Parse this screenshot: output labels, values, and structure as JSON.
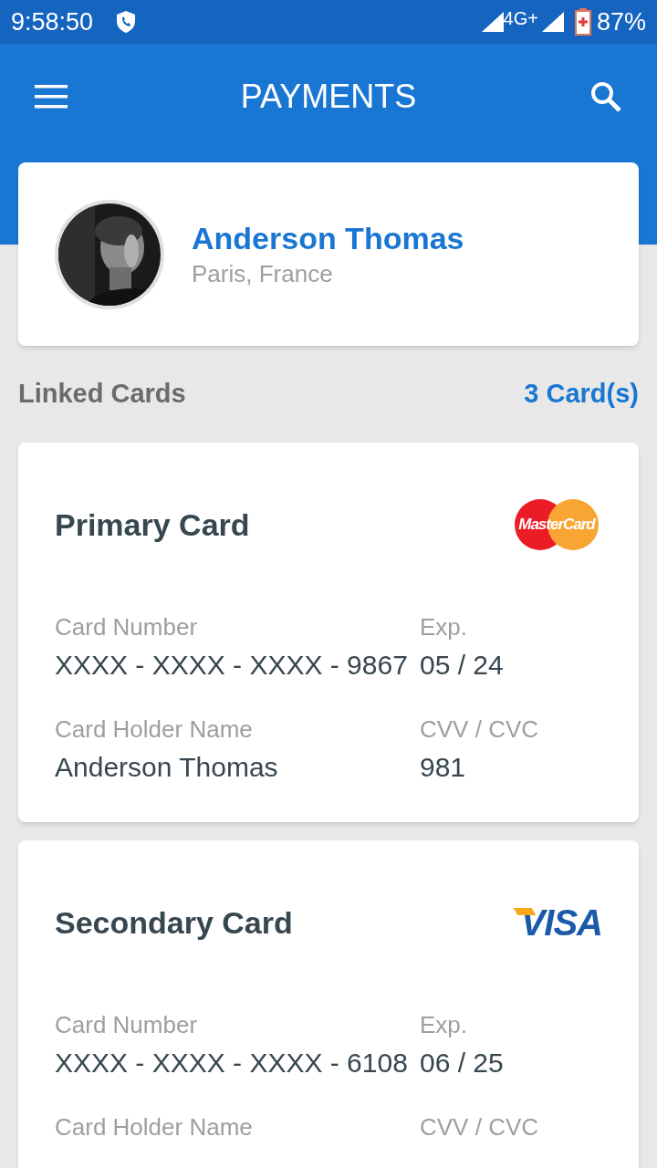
{
  "status_bar": {
    "time": "9:58:50",
    "network": "4G+",
    "battery": "87%"
  },
  "app_bar": {
    "title": "PAYMENTS"
  },
  "profile": {
    "name": "Anderson Thomas",
    "location": "Paris, France"
  },
  "section": {
    "title": "Linked Cards",
    "count": "3 Card(s)"
  },
  "cards": [
    {
      "title": "Primary Card",
      "logo": {
        "kind": "mastercard",
        "text": "MasterCard"
      },
      "fields": [
        {
          "label": "Card Number",
          "value": "XXXX - XXXX - XXXX - 9867"
        },
        {
          "label": "Exp.",
          "value": "05 / 24"
        },
        {
          "label": "Card Holder Name",
          "value": "Anderson Thomas"
        },
        {
          "label": "CVV / CVC",
          "value": "981"
        }
      ]
    },
    {
      "title": "Secondary Card",
      "logo": {
        "kind": "visa",
        "text": "VISA"
      },
      "fields": [
        {
          "label": "Card Number",
          "value": "XXXX - XXXX - XXXX - 6108"
        },
        {
          "label": "Exp.",
          "value": "06 / 25"
        },
        {
          "label": "Card Holder Name"
        },
        {
          "label": "CVV / CVC"
        }
      ]
    }
  ]
}
